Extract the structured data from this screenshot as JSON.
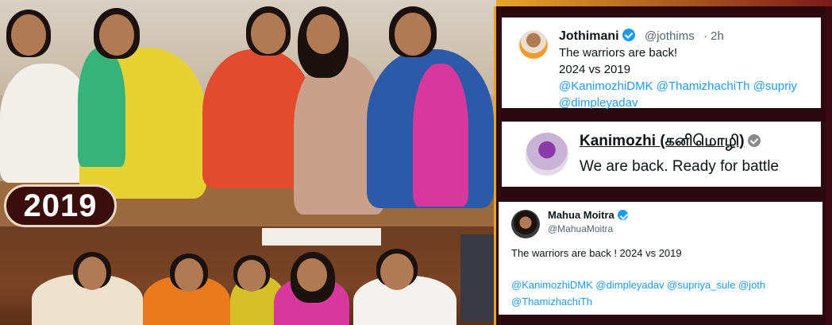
{
  "badge": {
    "year": "2019"
  },
  "tweets": [
    {
      "name": "Jothimani",
      "handle": "@jothims",
      "time": "· 2h",
      "line1": "The warriors are back!",
      "line2": "2024 vs 2019",
      "mentions1": "@KanimozhiDMK @ThamizhachiTh @supriy",
      "mentions2": "@dimpleyadav"
    },
    {
      "name": "Kanimozhi (கனிமொழி)",
      "text": "We are back. Ready for battle"
    },
    {
      "name": "Mahua Moitra",
      "handle": "@MahuaMoitra",
      "text": "The warriors are back ! 2024 vs 2019",
      "mentions1": "@KanimozhiDMK @dimpleyadav @supriya_sule @joth",
      "mentions2": "@ThamizhachiTh"
    }
  ],
  "colors": {
    "accent_gold": "#e7a22a",
    "link_blue": "#1d9bf0",
    "verified_blue": "#1d9bf0",
    "badge_bg": "#3b0e0e"
  }
}
